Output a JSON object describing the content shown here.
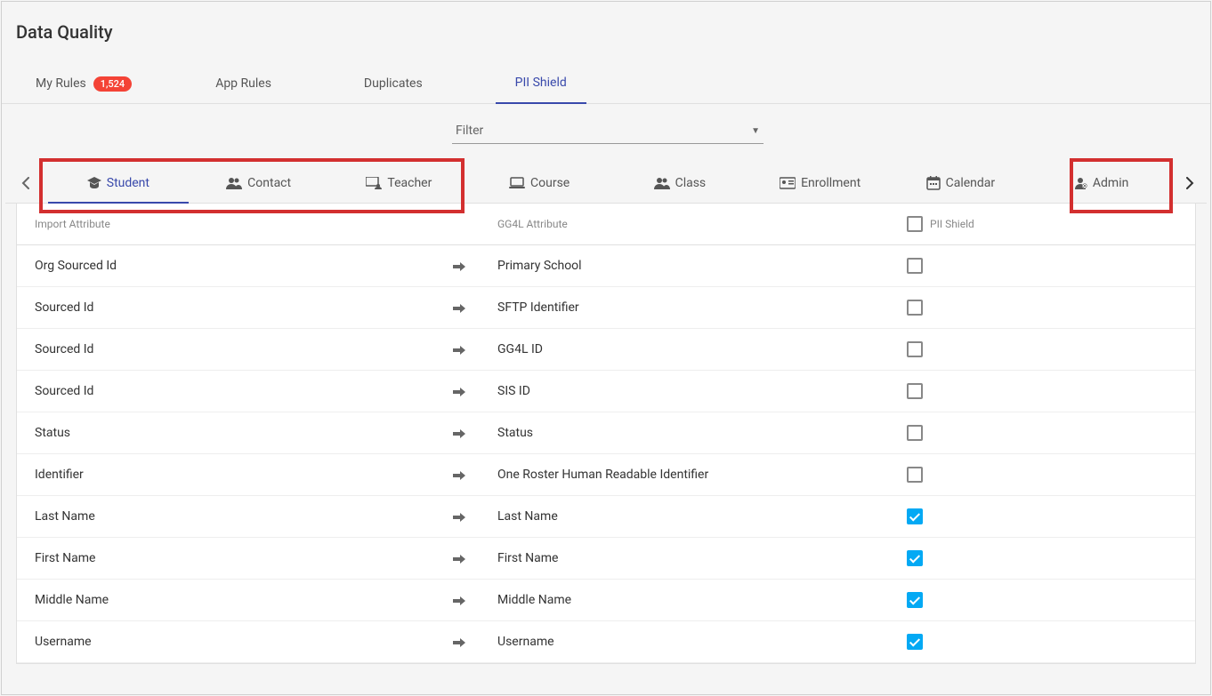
{
  "page": {
    "title": "Data Quality"
  },
  "mainTabs": {
    "items": [
      {
        "label": "My Rules",
        "badge": "1,524",
        "active": false
      },
      {
        "label": "App Rules",
        "active": false
      },
      {
        "label": "Duplicates",
        "active": false
      },
      {
        "label": "PII Shield",
        "active": true
      }
    ]
  },
  "filter": {
    "label": "Filter"
  },
  "entityTabs": {
    "items": [
      {
        "label": "Student",
        "icon": "graduate",
        "active": true
      },
      {
        "label": "Contact",
        "icon": "users",
        "active": false
      },
      {
        "label": "Teacher",
        "icon": "chalkboard",
        "active": false
      },
      {
        "label": "Course",
        "icon": "laptop",
        "active": false
      },
      {
        "label": "Class",
        "icon": "users",
        "active": false
      },
      {
        "label": "Enrollment",
        "icon": "card",
        "active": false
      },
      {
        "label": "Calendar",
        "icon": "calendar",
        "active": false
      },
      {
        "label": "Admin",
        "icon": "admin",
        "active": false
      }
    ]
  },
  "table": {
    "headers": {
      "import": "Import Attribute",
      "gg4l": "GG4L Attribute",
      "pii": "PII Shield"
    },
    "rows": [
      {
        "import": "Org Sourced Id",
        "gg4l": "Primary School",
        "checked": false
      },
      {
        "import": "Sourced Id",
        "gg4l": "SFTP Identifier",
        "checked": false
      },
      {
        "import": "Sourced Id",
        "gg4l": "GG4L ID",
        "checked": false
      },
      {
        "import": "Sourced Id",
        "gg4l": "SIS ID",
        "checked": false
      },
      {
        "import": "Status",
        "gg4l": "Status",
        "checked": false
      },
      {
        "import": "Identifier",
        "gg4l": "One Roster Human Readable Identifier",
        "checked": false
      },
      {
        "import": "Last Name",
        "gg4l": "Last Name",
        "checked": true
      },
      {
        "import": "First Name",
        "gg4l": "First Name",
        "checked": true
      },
      {
        "import": "Middle Name",
        "gg4l": "Middle Name",
        "checked": true
      },
      {
        "import": "Username",
        "gg4l": "Username",
        "checked": true
      }
    ]
  }
}
